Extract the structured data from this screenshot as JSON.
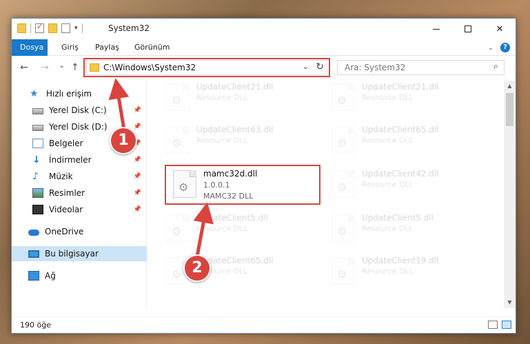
{
  "window": {
    "title": "System32",
    "controls": {
      "minimize": "",
      "maximize": "",
      "close": "✕"
    }
  },
  "ribbon": {
    "tabs": [
      {
        "label": "Dosya",
        "active": true
      },
      {
        "label": "Giriş"
      },
      {
        "label": "Paylaş"
      },
      {
        "label": "Görünüm"
      }
    ],
    "expand_icon": "chevron-down-icon",
    "help_label": "?"
  },
  "nav": {
    "back": "←",
    "forward": "→",
    "recent": "⌄",
    "up": "↑",
    "address": "C:\\Windows\\System32",
    "search_placeholder": "Ara: System32"
  },
  "sidebar": {
    "items": [
      {
        "label": "Hızlı erişim",
        "icon": "star-icon"
      },
      {
        "label": "Yerel Disk (C:)",
        "icon": "drive-icon",
        "pinned": true
      },
      {
        "label": "Yerel Disk (D:)",
        "icon": "drive-icon",
        "pinned": true
      },
      {
        "label": "Belgeler",
        "icon": "documents-icon",
        "pinned": true
      },
      {
        "label": "İndirmeler",
        "icon": "downloads-icon",
        "pinned": true
      },
      {
        "label": "Müzik",
        "icon": "music-icon",
        "pinned": true
      },
      {
        "label": "Resimler",
        "icon": "pictures-icon",
        "pinned": true
      },
      {
        "label": "Videolar",
        "icon": "videos-icon",
        "pinned": true
      },
      {
        "label": "OneDrive",
        "icon": "onedrive-icon"
      },
      {
        "label": "Bu bilgisayar",
        "icon": "computer-icon",
        "selected": true
      },
      {
        "label": "Ağ",
        "icon": "network-icon"
      }
    ]
  },
  "files": [
    {
      "name": "UpdateClient21.dll",
      "desc": "Resource DLL",
      "faded": true
    },
    {
      "name": "UpdateClient21.dll",
      "desc": "Resource DLL",
      "faded": true
    },
    {
      "name": "UpdateClient63.dll",
      "desc": "Resource DLL",
      "faded": true
    },
    {
      "name": "UpdateClient65.dll",
      "desc": "Resource DLL",
      "faded": true
    },
    {
      "name": "mamc32d.dll",
      "version": "1.0.0.1",
      "desc": "MAMC32 DLL",
      "faded": false,
      "highlighted": true
    },
    {
      "name": "UpdateClient42.dll",
      "desc": "Resource DLL",
      "faded": true
    },
    {
      "name": "UpdateClient5.dll",
      "desc": "Resource DLL",
      "faded": true
    },
    {
      "name": "UpdateClient5.dll",
      "desc": "Resource DLL",
      "faded": true
    },
    {
      "name": "UpdateClient65.dll",
      "desc": "Resource DLL",
      "faded": true
    },
    {
      "name": "UpdateClient19.dll",
      "desc": "Resource DLL",
      "faded": true
    }
  ],
  "status": {
    "item_count": "190 öğe"
  },
  "annotations": [
    {
      "number": "1",
      "color": "#d9443f"
    },
    {
      "number": "2",
      "color": "#d9443f"
    }
  ],
  "colors": {
    "accent": "#1979ca",
    "highlight": "#d9443f",
    "selected": "#cce4f7"
  }
}
